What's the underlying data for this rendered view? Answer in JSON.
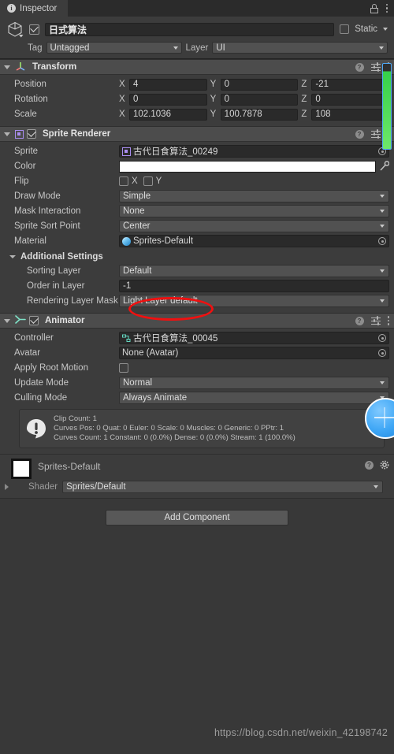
{
  "window": {
    "tab_label": "Inspector",
    "info_glyph": "i",
    "lock_icon": "lock-icon",
    "menu_icon": "kebab-menu-icon"
  },
  "gameobject": {
    "name": "日式算法",
    "enabled": true,
    "static_label": "Static",
    "static_checked": false,
    "tag_label": "Tag",
    "tag_value": "Untagged",
    "layer_label": "Layer",
    "layer_value": "UI"
  },
  "transform": {
    "title": "Transform",
    "rows": [
      {
        "label": "Position",
        "x": "4",
        "y": "0",
        "z": "-21"
      },
      {
        "label": "Rotation",
        "x": "0",
        "y": "0",
        "z": "0"
      },
      {
        "label": "Scale",
        "x": "102.1036",
        "y": "100.7878",
        "z": "108"
      }
    ],
    "axis_x": "X",
    "axis_y": "Y",
    "axis_z": "Z"
  },
  "sprite_renderer": {
    "title": "Sprite Renderer",
    "enabled": true,
    "sprite_label": "Sprite",
    "sprite_value": "古代日食算法_00249",
    "color_label": "Color",
    "color_value": "#FFFFFF",
    "flip_label": "Flip",
    "flip_x_label": "X",
    "flip_y_label": "Y",
    "flip_x": false,
    "flip_y": false,
    "draw_mode_label": "Draw Mode",
    "draw_mode_value": "Simple",
    "mask_interaction_label": "Mask Interaction",
    "mask_interaction_value": "None",
    "sort_point_label": "Sprite Sort Point",
    "sort_point_value": "Center",
    "material_label": "Material",
    "material_value": "Sprites-Default",
    "additional_settings_label": "Additional Settings",
    "sorting_layer_label": "Sorting Layer",
    "sorting_layer_value": "Default",
    "order_in_layer_label": "Order in Layer",
    "order_in_layer_value": "-1",
    "rendering_layer_mask_label": "Rendering Layer Mask",
    "rendering_layer_mask_value": "Light Layer default"
  },
  "animator": {
    "title": "Animator",
    "enabled": true,
    "controller_label": "Controller",
    "controller_value": "古代日食算法_00045",
    "avatar_label": "Avatar",
    "avatar_value": "None (Avatar)",
    "apply_root_motion_label": "Apply Root Motion",
    "apply_root_motion": false,
    "update_mode_label": "Update Mode",
    "update_mode_value": "Normal",
    "culling_mode_label": "Culling Mode",
    "culling_mode_value": "Always Animate",
    "info_lines": [
      "Clip Count: 1",
      "Curves Pos: 0 Quat: 0 Euler: 0 Scale: 0 Muscles: 0 Generic: 0 PPtr: 1",
      "Curves Count: 1 Constant: 0 (0.0%) Dense: 0 (0.0%) Stream: 1 (100.0%)"
    ]
  },
  "material_panel": {
    "name": "Sprites-Default",
    "shader_label": "Shader",
    "shader_value": "Sprites/Default"
  },
  "footer": {
    "add_component_label": "Add Component",
    "watermark": "https://blog.csdn.net/weixin_42198742"
  },
  "annotation": {
    "shape": "red-ellipse",
    "targets": "order-in-layer-row"
  },
  "colors": {
    "panel_bg": "#3c3c3c",
    "window_bg": "#383838",
    "header_bg": "#4c4c4c",
    "field_bg": "#2a2a2a",
    "dropdown_bg": "#515151",
    "annotation_red": "#f01010",
    "cursor_blue": "#3ea6f5",
    "sprite_accent": "#a98df0"
  }
}
